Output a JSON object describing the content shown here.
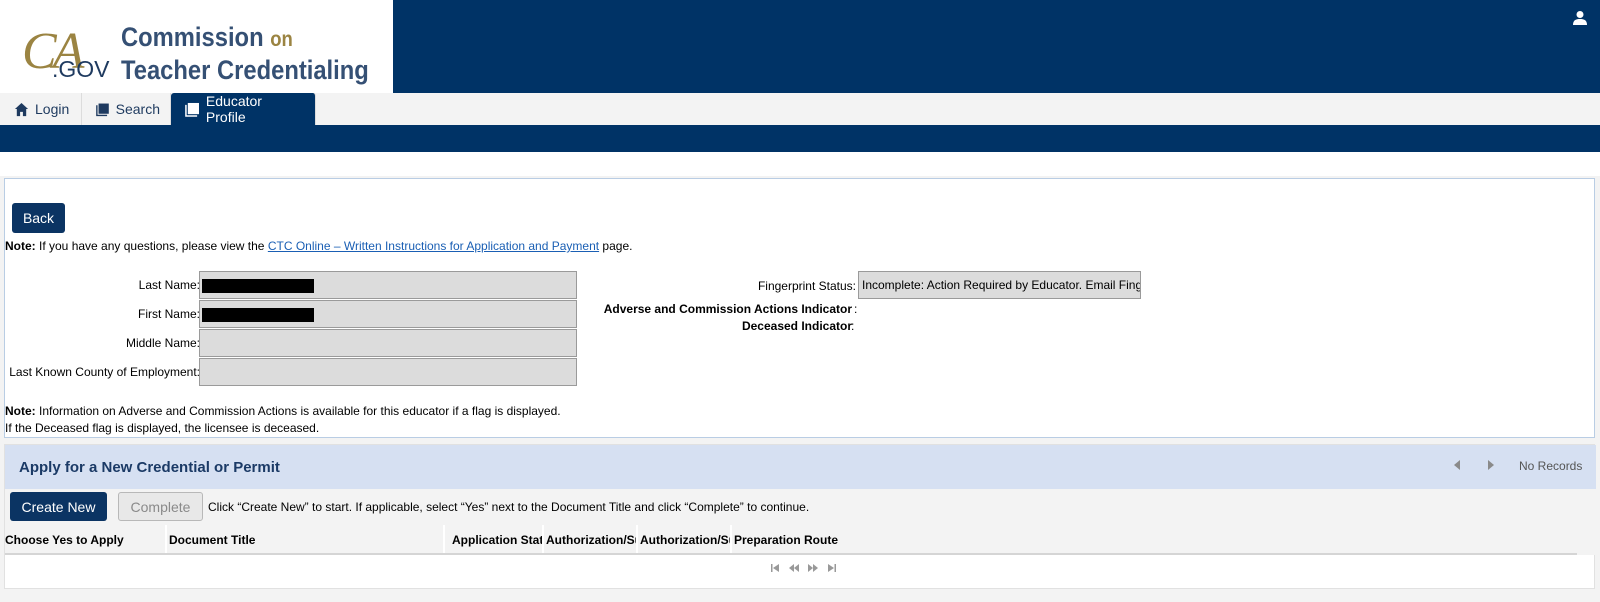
{
  "header": {
    "logo_mark": "CA",
    "logo_gov": ".GOV",
    "org_line1": "Commission",
    "org_on": "on",
    "org_line2": "Teacher Credentialing",
    "brand_color": "#003366",
    "gold_color": "#9b8442"
  },
  "tabs": [
    {
      "label": "Login",
      "icon": "home-icon"
    },
    {
      "label": "Search",
      "icon": "search-page-icon"
    },
    {
      "label": "Educator Profile",
      "icon": "profile-page-icon",
      "active": true
    }
  ],
  "profile": {
    "back_label": "Back",
    "note_prefix": "Note:",
    "note_text": " If you have any questions, please view the ",
    "note_link": "CTC Online – Written Instructions for Application and Payment",
    "note_suffix": " page.",
    "fields": {
      "last_name_label": "Last Name:",
      "first_name_label": "First Name:",
      "middle_name_label": "Middle Name:",
      "county_label": "Last Known County of Employment:",
      "middle_name_value": "",
      "county_value": ""
    },
    "fingerprint_label": "Fingerprint Status:",
    "fingerprint_value": "Incomplete: Action Required by Educator. Email Fingerprint",
    "adverse_label": "Adverse and Commission Actions Indicator",
    "deceased_label": "Deceased Indicator",
    "colon": ":",
    "colon_spaced": " :",
    "footnote_prefix": "Note:",
    "footnote_line1": " Information on Adverse and Commission Actions is available for this educator if a flag is displayed.",
    "footnote_line2": "If the Deceased flag is displayed, the licensee is deceased."
  },
  "apply": {
    "title": "Apply for a New Credential or Permit",
    "no_records": "No Records",
    "create_label": "Create New",
    "complete_label": "Complete",
    "hint": "Click “Create New” to start. If applicable, select “Yes” next to the Document Title and click “Complete” to continue.",
    "columns": [
      "Choose Yes to Apply",
      "Document Title",
      "Application Status",
      "Authorization/Subject",
      "Authorization/Subject",
      "Preparation Route"
    ]
  }
}
